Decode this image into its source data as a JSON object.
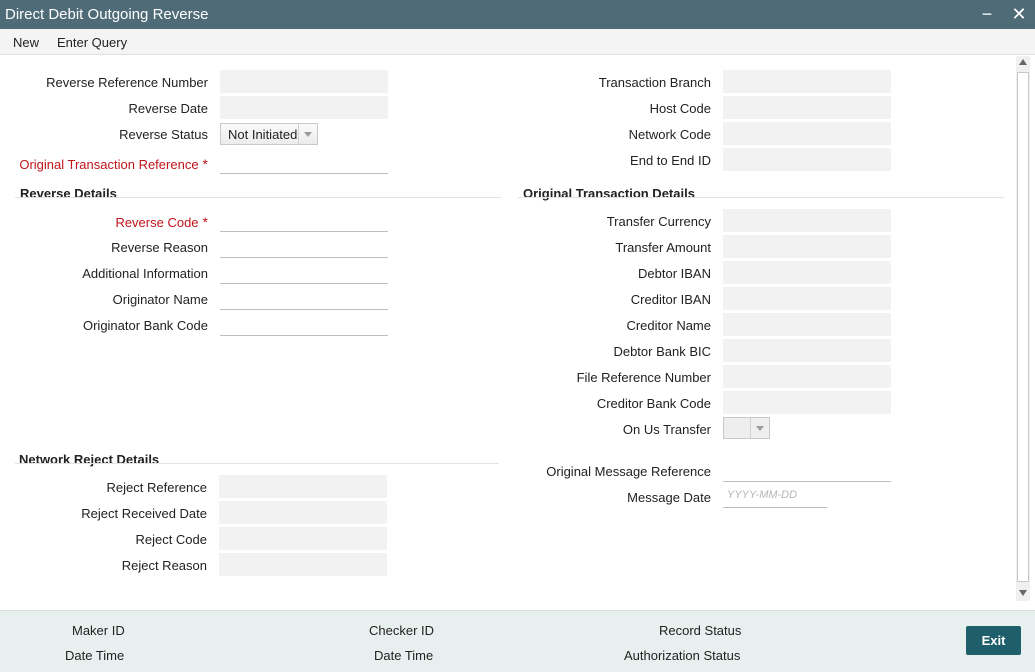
{
  "window": {
    "title": "Direct Debit Outgoing Reverse",
    "minimize": "−",
    "close": "✕"
  },
  "menu": {
    "new": "New",
    "enter_query": "Enter Query"
  },
  "main": {
    "reverse_reference_number": "Reverse Reference Number",
    "reverse_date": "Reverse Date",
    "reverse_status": "Reverse Status",
    "reverse_status_value": "Not Initiated",
    "original_txn_ref": "Original Transaction Reference",
    "transaction_branch": "Transaction Branch",
    "host_code": "Host Code",
    "network_code": "Network Code",
    "end_to_end_id": "End to End ID"
  },
  "reverse_details": {
    "header": "Reverse Details",
    "reverse_code": "Reverse Code",
    "reverse_reason": "Reverse Reason",
    "additional_information": "Additional Information",
    "originator_name": "Originator Name",
    "originator_bank_code": "Originator Bank Code"
  },
  "original_details": {
    "header": "Original Transaction Details",
    "transfer_currency": "Transfer Currency",
    "transfer_amount": "Transfer Amount",
    "debtor_iban": "Debtor IBAN",
    "creditor_iban": "Creditor IBAN",
    "creditor_name": "Creditor Name",
    "debtor_bank_bic": "Debtor Bank BIC",
    "file_reference_number": "File Reference Number",
    "creditor_bank_code": "Creditor Bank Code",
    "on_us_transfer": "On Us Transfer",
    "original_message_reference": "Original Message Reference",
    "message_date": "Message Date",
    "message_date_placeholder": "YYYY-MM-DD"
  },
  "network_reject": {
    "header": "Network Reject Details",
    "reject_reference": "Reject Reference",
    "reject_received_date": "Reject Received Date",
    "reject_code": "Reject Code",
    "reject_reason": "Reject Reason"
  },
  "footer": {
    "maker_id": "Maker ID",
    "maker_date_time": "Date Time",
    "checker_id": "Checker ID",
    "checker_date_time": "Date Time",
    "record_status": "Record Status",
    "authorization_status": "Authorization Status",
    "exit": "Exit"
  },
  "required_mark": "*"
}
